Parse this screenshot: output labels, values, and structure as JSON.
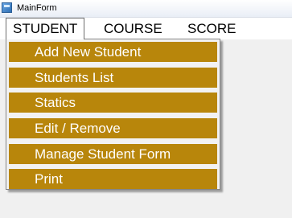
{
  "window": {
    "title": "MainForm",
    "icon": "app-icon"
  },
  "menubar": {
    "items": [
      {
        "label": "STUDENT"
      },
      {
        "label": "COURSE"
      },
      {
        "label": "SCORE"
      }
    ]
  },
  "dropdown": {
    "items": [
      {
        "label": "Add New Student"
      },
      {
        "label": "Students List"
      },
      {
        "label": "Statics"
      },
      {
        "label": "Edit / Remove"
      },
      {
        "label": "Manage Student Form"
      },
      {
        "label": "Print"
      }
    ]
  },
  "colors": {
    "menu_item_background": "#b8860b",
    "menu_item_text": "#ffffff"
  }
}
